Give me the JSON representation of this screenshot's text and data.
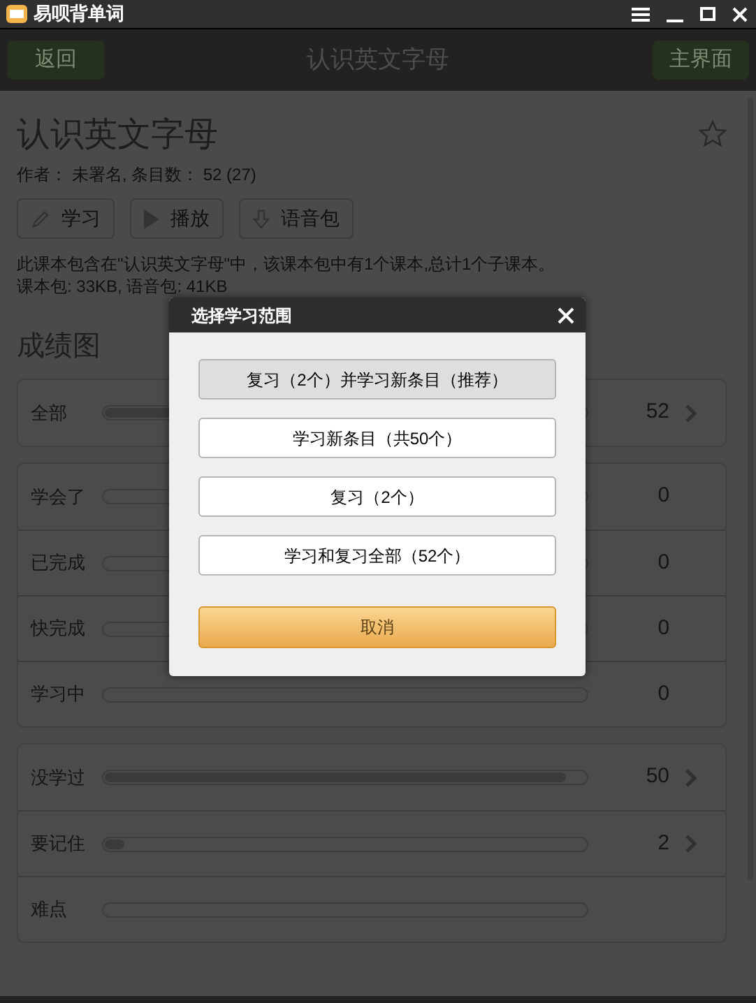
{
  "window": {
    "title": "易呗背单词"
  },
  "nav": {
    "back": "返回",
    "title": "认识英文字母",
    "home": "主界面"
  },
  "course": {
    "title": "认识英文字母",
    "favorite": false,
    "meta": "作者： 未署名, 条目数： 52 (27)",
    "actions": [
      {
        "kind": "pencil",
        "label": "学习"
      },
      {
        "kind": "play",
        "label": "播放"
      },
      {
        "kind": "download",
        "label": "语音包"
      }
    ],
    "description": "此课本包含在\"认识英文字母\"中，该课本包中有1个课本,总计1个子课本。",
    "sizes": "课本包: 33KB, 语音包: 41KB"
  },
  "stats": {
    "title": "成绩图",
    "groups": [
      [
        {
          "label": "全部",
          "level": 1,
          "value": "52",
          "chevron": true
        }
      ],
      [
        {
          "label": "学会了",
          "value": "0",
          "chevron": false
        },
        {
          "label": "已完成",
          "value": "0",
          "chevron": false
        },
        {
          "label": "快完成",
          "value": "0",
          "chevron": false
        },
        {
          "label": "学习中",
          "value": "0",
          "chevron": false
        }
      ],
      [
        {
          "label": "没学过",
          "level": 0.96,
          "value": "50",
          "chevron": true
        },
        {
          "label": "要记住",
          "level": 0.04,
          "value": "2",
          "chevron": true
        },
        {
          "label": "难点",
          "chevron": false
        }
      ]
    ]
  },
  "dialog": {
    "title": "选择学习范围",
    "options": [
      {
        "label": "复习（2个）并学习新条目（推荐）",
        "selected": true
      },
      {
        "label": "学习新条目（共50个）",
        "selected": false
      },
      {
        "label": "复习（2个）",
        "selected": false
      },
      {
        "label": "学习和复习全部（52个）",
        "selected": false
      }
    ],
    "cancel": "取消"
  }
}
